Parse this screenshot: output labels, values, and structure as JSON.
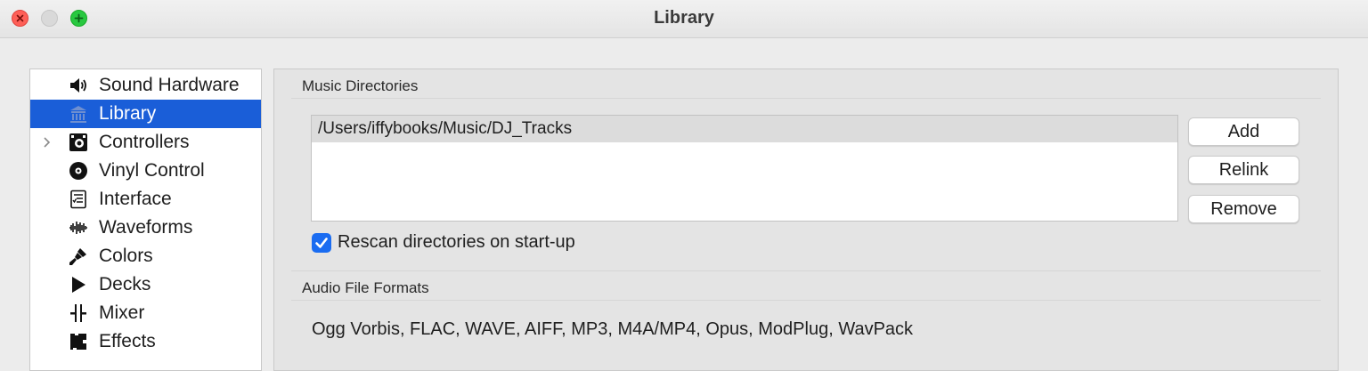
{
  "window": {
    "title": "Library"
  },
  "sidebar": {
    "items": [
      {
        "label": "Sound Hardware",
        "icon": "speaker-icon"
      },
      {
        "label": "Library",
        "icon": "library-icon",
        "selected": true
      },
      {
        "label": "Controllers",
        "icon": "controller-icon",
        "expandable": true
      },
      {
        "label": "Vinyl Control",
        "icon": "vinyl-icon"
      },
      {
        "label": "Interface",
        "icon": "interface-icon"
      },
      {
        "label": "Waveforms",
        "icon": "waveform-icon"
      },
      {
        "label": "Colors",
        "icon": "paint-brush-icon"
      },
      {
        "label": "Decks",
        "icon": "play-icon"
      },
      {
        "label": "Mixer",
        "icon": "mixer-fader-icon"
      },
      {
        "label": "Effects",
        "icon": "effects-icon"
      }
    ]
  },
  "music_directories": {
    "title": "Music Directories",
    "directories": [
      "/Users/iffybooks/Music/DJ_Tracks"
    ],
    "buttons": {
      "add": "Add",
      "relink": "Relink",
      "remove": "Remove"
    },
    "rescan_label": "Rescan directories on start-up",
    "rescan_checked": true
  },
  "audio_formats": {
    "title": "Audio File Formats",
    "formats_text": "Ogg Vorbis, FLAC, WAVE, AIFF, MP3, M4A/MP4, Opus, ModPlug, WavPack"
  },
  "colors": {
    "selection": "#1a5ed8",
    "checkbox": "#1a6cf1",
    "close": "#fe5f57",
    "maximize": "#28c840"
  }
}
